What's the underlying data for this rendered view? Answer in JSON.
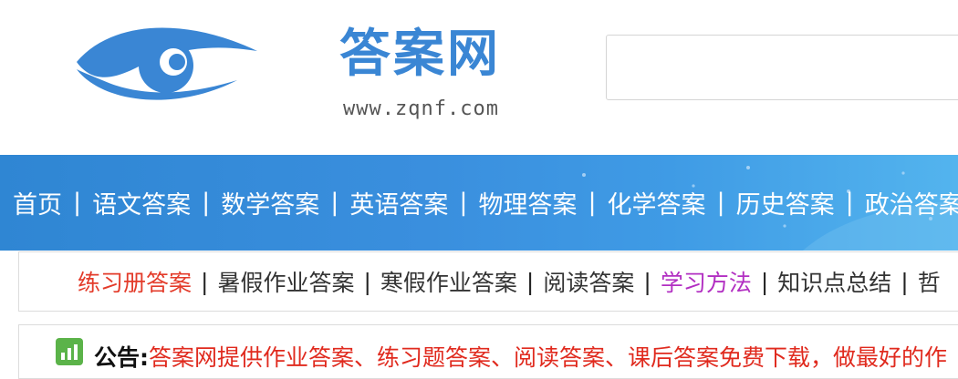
{
  "logo": {
    "title": "答案网",
    "url": "www.zqnf.com"
  },
  "search": {
    "placeholder": ""
  },
  "nav": {
    "items": [
      "首页",
      "语文答案",
      "数学答案",
      "英语答案",
      "物理答案",
      "化学答案",
      "历史答案",
      "政治答案"
    ],
    "separator": "|"
  },
  "subnav": {
    "items": [
      "练习册答案",
      "暑假作业答案",
      "寒假作业答案",
      "阅读答案",
      "学习方法",
      "知识点总结",
      "哲"
    ],
    "separator": "|"
  },
  "notice": {
    "label": "公告:",
    "text": "答案网提供作业答案、练习题答案、阅读答案、课后答案免费下载，做最好的作"
  },
  "colors": {
    "brand_blue": "#3a86d4",
    "nav_bg": "#2f86d3",
    "highlight_red": "#e33b2a",
    "highlight_purple": "#b22fc2",
    "notice_red": "#e02a1e"
  }
}
